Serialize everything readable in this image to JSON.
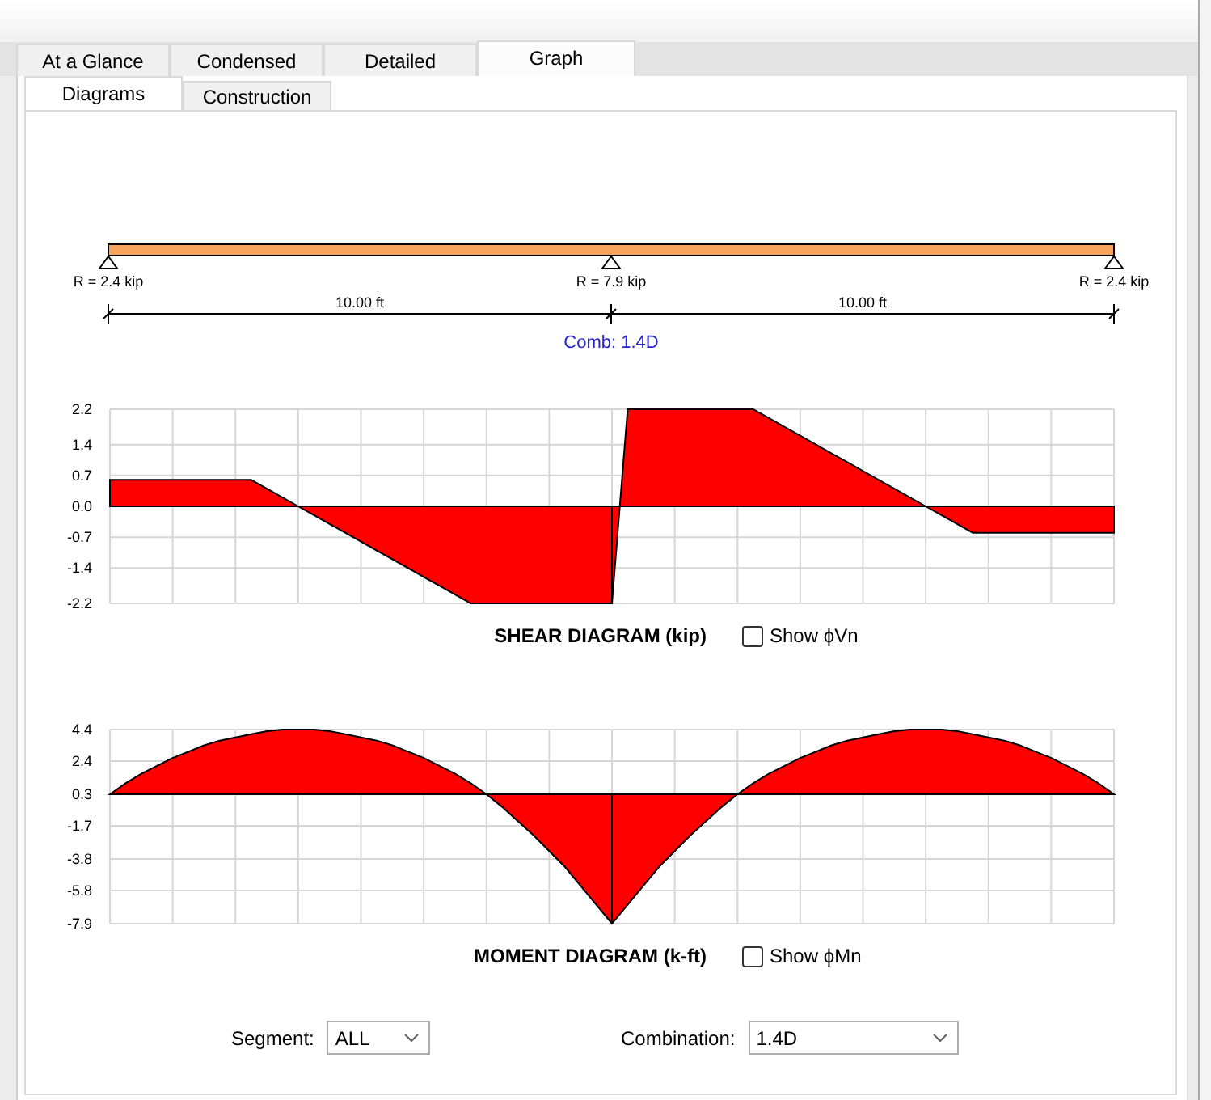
{
  "tabs": [
    {
      "label": "At a Glance",
      "selected": false
    },
    {
      "label": "Condensed",
      "selected": false
    },
    {
      "label": "Detailed",
      "selected": false
    },
    {
      "label": "Graph",
      "selected": true
    }
  ],
  "subtabs": [
    {
      "label": "Diagrams",
      "selected": true
    },
    {
      "label": "Construction",
      "selected": false
    }
  ],
  "beam": {
    "supports": [
      {
        "reaction": "R = 2.4 kip"
      },
      {
        "reaction": "R = 7.9 kip"
      },
      {
        "reaction": "R = 2.4 kip"
      }
    ],
    "spans": [
      {
        "length": "10.00 ft"
      },
      {
        "length": "10.00 ft"
      }
    ],
    "combination": "Comb: 1.4D"
  },
  "diagrams": [
    {
      "chart_data": {
        "type": "area",
        "title": "SHEAR DIAGRAM (kip)",
        "categories": [
          null,
          null,
          null,
          null,
          null,
          null,
          null,
          null,
          null,
          null,
          null,
          null,
          null,
          null,
          null,
          null,
          null,
          null,
          null,
          null,
          null,
          null,
          null,
          null,
          null,
          null,
          null,
          null,
          null,
          null,
          null,
          null,
          null,
          null,
          null,
          null,
          null,
          null,
          null,
          null,
          null,
          null,
          null,
          null,
          null,
          null,
          null,
          null,
          null,
          null,
          null,
          null,
          null,
          null,
          null,
          null,
          null,
          null,
          null,
          null,
          null,
          null,
          null,
          null,
          null
        ],
        "series": [
          {
            "color": "#ff0000",
            "values": [
              0.6,
              0.6,
              0.6,
              0.6,
              0.6,
              0.6,
              0.6,
              0.6,
              0.6,
              0.6,
              0.4,
              0.2,
              0,
              -0.2,
              -0.4,
              -0.6,
              -0.8,
              -1.0,
              -1.2,
              -1.4,
              -1.6,
              -1.8,
              -2.0,
              -2.2,
              -2.2,
              -2.2,
              -2.2,
              -2.2,
              -2.2,
              -2.2,
              -2.2,
              -2.2,
              -2.2,
              2.2,
              2.2,
              2.2,
              2.2,
              2.2,
              2.2,
              2.2,
              2.2,
              2.2,
              2.0,
              1.8,
              1.6,
              1.4,
              1.2,
              1.0,
              0.8,
              0.6,
              0.4,
              0.2,
              0,
              -0.2,
              -0.4,
              -0.6,
              -0.6,
              -0.6,
              -0.6,
              -0.6,
              -0.6,
              -0.6,
              -0.6,
              -0.6,
              -0.6
            ]
          }
        ],
        "ylim": [
          -2.2,
          2.2
        ],
        "yticks": [
          2.2,
          1.4,
          0.7,
          {
            "value": 0,
            "label": "0.0"
          },
          -0.7,
          -1.4,
          -2.2
        ],
        "grid": true
      },
      "show_option": {
        "label": "Show ϕVn",
        "checked": false
      }
    },
    {
      "chart_data": {
        "type": "area",
        "title": "MOMENT DIAGRAM (k-ft)",
        "categories": [
          null,
          null,
          null,
          null,
          null,
          null,
          null,
          null,
          null,
          null,
          null,
          null,
          null,
          null,
          null,
          null,
          null,
          null,
          null,
          null,
          null,
          null,
          null,
          null,
          null,
          null,
          null,
          null,
          null,
          null,
          null,
          null,
          null,
          null,
          null,
          null,
          null,
          null,
          null,
          null,
          null,
          null,
          null,
          null,
          null,
          null,
          null,
          null,
          null,
          null,
          null,
          null,
          null,
          null,
          null,
          null,
          null,
          null,
          null,
          null,
          null,
          null,
          null,
          null,
          null
        ],
        "series": [
          {
            "color": "#ff0000",
            "values": [
              0.3,
              1.0,
              1.6,
              2.1,
              2.6,
              3.0,
              3.4,
              3.7,
              3.9,
              4.1,
              4.3,
              4.4,
              4.4,
              4.4,
              4.3,
              4.1,
              3.9,
              3.7,
              3.4,
              3.0,
              2.6,
              2.1,
              1.6,
              1.0,
              0.3,
              -0.5,
              -1.4,
              -2.3,
              -3.3,
              -4.3,
              -5.5,
              -6.7,
              -7.9,
              -6.7,
              -5.5,
              -4.3,
              -3.3,
              -2.3,
              -1.4,
              -0.5,
              0.3,
              1.0,
              1.6,
              2.1,
              2.6,
              3.0,
              3.4,
              3.7,
              3.9,
              4.1,
              4.3,
              4.4,
              4.4,
              4.4,
              4.3,
              4.1,
              3.9,
              3.7,
              3.4,
              3.0,
              2.6,
              2.1,
              1.6,
              1.0,
              0.3
            ]
          }
        ],
        "ylim": [
          -7.9,
          4.4
        ],
        "yticks": [
          4.4,
          2.4,
          0.3,
          -1.7,
          -3.8,
          -5.8,
          -7.9
        ],
        "grid": true
      },
      "show_option": {
        "label": "Show ϕMn",
        "checked": false
      }
    }
  ],
  "segment_selector": {
    "label": "Segment:",
    "value": "ALL"
  },
  "combination_selector": {
    "label": "Combination:",
    "value": "1.4D"
  }
}
